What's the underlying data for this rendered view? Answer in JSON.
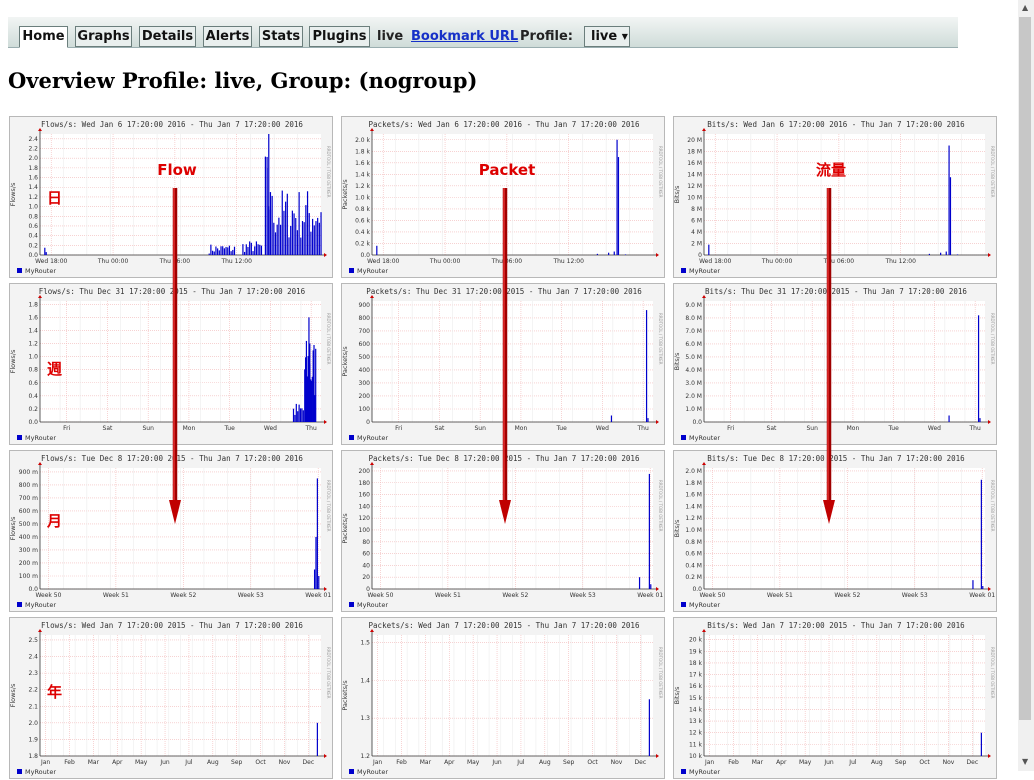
{
  "nav": {
    "tabs": [
      "Home",
      "Graphs",
      "Details",
      "Alerts",
      "Stats",
      "Plugins"
    ],
    "active_tab": "Home",
    "profile_name": "live",
    "bookmark_label": "Bookmark URL",
    "profile_label": "Profile:",
    "profile_select": "live"
  },
  "page": {
    "title": "Overview Profile: live, Group: (nogroup)"
  },
  "annotations": {
    "columns": [
      "Flow",
      "Packet",
      "流量"
    ],
    "rows": [
      "日",
      "週",
      "月",
      "年"
    ],
    "color": "#dd0000"
  },
  "colors": {
    "series": "#0000cc",
    "grid": "#f2b8b8",
    "plot_bg": "#ffffff",
    "panel_bg": "#f3f3f3"
  },
  "legend": "MyRouter",
  "side_label": "RRDTOOL / TOBI OETIKER",
  "chart_data": [
    {
      "type": "bar",
      "title": "Flows/s: Wed Jan  6 17:20:00 2016 - Thu Jan  7 17:20:00 2016",
      "ylabel": "Flows/s",
      "yticks": [
        "0.0",
        "0.2",
        "0.4",
        "0.6",
        "0.8",
        "1.0",
        "1.2",
        "1.4",
        "1.6",
        "1.8",
        "2.0",
        "2.2",
        "2.4"
      ],
      "ylim": [
        0,
        2.5
      ],
      "xticks": [
        "Wed 18:00",
        "Thu 00:00",
        "Thu 06:00",
        "Thu 12:00"
      ],
      "xtick_pos": [
        0.04,
        0.26,
        0.48,
        0.7
      ],
      "gridx": 12,
      "series": "flow_day",
      "peak": 2.5
    },
    {
      "type": "bar",
      "title": "Packets/s: Wed Jan  6 17:20:00 2016 - Thu Jan  7 17:20:00 2016",
      "ylabel": "Packets/s",
      "yticks": [
        "0.0",
        "0.2 k",
        "0.4 k",
        "0.6 k",
        "0.8 k",
        "1.0 k",
        "1.2 k",
        "1.4 k",
        "1.6 k",
        "1.8 k",
        "2.0 k"
      ],
      "ylim": [
        0,
        2.1
      ],
      "xticks": [
        "Wed 18:00",
        "Thu 00:00",
        "Thu 06:00",
        "Thu 12:00"
      ],
      "xtick_pos": [
        0.04,
        0.26,
        0.48,
        0.7
      ],
      "gridx": 12,
      "series": [
        [
          0.015,
          0.16
        ],
        [
          0.8,
          0.02
        ],
        [
          0.84,
          0.04
        ],
        [
          0.86,
          0.06
        ],
        [
          0.87,
          2.0
        ],
        [
          0.875,
          1.7
        ],
        [
          0.9,
          0.01
        ]
      ]
    },
    {
      "type": "bar",
      "title": "Bits/s: Wed Jan  6 17:20:00 2016 - Thu Jan  7 17:20:00 2016",
      "ylabel": "Bits/s",
      "yticks": [
        "0",
        "2 M",
        "4 M",
        "6 M",
        "8 M",
        "10 M",
        "12 M",
        "14 M",
        "16 M",
        "18 M",
        "20 M"
      ],
      "ylim": [
        0,
        21
      ],
      "xticks": [
        "Wed 18:00",
        "Thu 00:00",
        "Thu 06:00",
        "Thu 12:00"
      ],
      "xtick_pos": [
        0.04,
        0.26,
        0.48,
        0.7
      ],
      "gridx": 12,
      "series": [
        [
          0.015,
          1.8
        ],
        [
          0.8,
          0.2
        ],
        [
          0.84,
          0.4
        ],
        [
          0.86,
          0.6
        ],
        [
          0.87,
          19.0
        ],
        [
          0.875,
          13.5
        ],
        [
          0.9,
          0.1
        ]
      ]
    },
    {
      "type": "bar",
      "title": "Flows/s: Thu Dec 31 17:20:00 2015 - Thu Jan  7 17:20:00 2016",
      "ylabel": "Flows/s",
      "yticks": [
        "0.0",
        "0.2",
        "0.4",
        "0.6",
        "0.8",
        "1.0",
        "1.2",
        "1.4",
        "1.6",
        "1.8"
      ],
      "ylim": [
        0,
        1.85
      ],
      "xticks": [
        "Fri",
        "Sat",
        "Sun",
        "Mon",
        "Tue",
        "Wed",
        "Thu"
      ],
      "xtick_pos": [
        0.095,
        0.24,
        0.385,
        0.53,
        0.675,
        0.82,
        0.965
      ],
      "gridx": 14,
      "series": "flow_week",
      "peak": 1.6
    },
    {
      "type": "bar",
      "title": "Packets/s: Thu Dec 31 17:20:00 2015 - Thu Jan  7 17:20:00 2016",
      "ylabel": "Packets/s",
      "yticks": [
        "0",
        "100",
        "200",
        "300",
        "400",
        "500",
        "600",
        "700",
        "800",
        "900"
      ],
      "ylim": [
        0,
        930
      ],
      "xticks": [
        "Fri",
        "Sat",
        "Sun",
        "Mon",
        "Tue",
        "Wed",
        "Thu"
      ],
      "xtick_pos": [
        0.095,
        0.24,
        0.385,
        0.53,
        0.675,
        0.82,
        0.965
      ],
      "gridx": 14,
      "series": [
        [
          0.85,
          50
        ],
        [
          0.975,
          860
        ],
        [
          0.98,
          30
        ]
      ]
    },
    {
      "type": "bar",
      "title": "Bits/s: Thu Dec 31 17:20:00 2015 - Thu Jan  7 17:20:00 2016",
      "ylabel": "Bits/s",
      "yticks": [
        "0.0",
        "1.0 M",
        "2.0 M",
        "3.0 M",
        "4.0 M",
        "5.0 M",
        "6.0 M",
        "7.0 M",
        "8.0 M",
        "9.0 M"
      ],
      "ylim": [
        0,
        9.3
      ],
      "xticks": [
        "Fri",
        "Sat",
        "Sun",
        "Mon",
        "Tue",
        "Wed",
        "Thu"
      ],
      "xtick_pos": [
        0.095,
        0.24,
        0.385,
        0.53,
        0.675,
        0.82,
        0.965
      ],
      "gridx": 14,
      "series": [
        [
          0.87,
          0.5
        ],
        [
          0.975,
          8.2
        ],
        [
          0.98,
          0.3
        ]
      ]
    },
    {
      "type": "bar",
      "title": "Flows/s: Tue Dec  8 17:20:00 2015 - Thu Jan  7 17:20:00 2016",
      "ylabel": "Flows/s",
      "yticks": [
        "0.0",
        "100 m",
        "200 m",
        "300 m",
        "400 m",
        "500 m",
        "600 m",
        "700 m",
        "800 m",
        "900 m"
      ],
      "ylim": [
        0,
        930
      ],
      "xticks": [
        "Week 50",
        "Week 51",
        "Week 52",
        "Week 53",
        "Week 01"
      ],
      "xtick_pos": [
        0.03,
        0.27,
        0.51,
        0.75,
        0.99
      ],
      "gridx": 12,
      "series": [
        [
          0.975,
          150
        ],
        [
          0.98,
          400
        ],
        [
          0.985,
          850
        ],
        [
          0.99,
          100
        ]
      ]
    },
    {
      "type": "bar",
      "title": "Packets/s: Tue Dec  8 17:20:00 2015 - Thu Jan  7 17:20:00 2016",
      "ylabel": "Packets/s",
      "yticks": [
        "0",
        "20",
        "40",
        "60",
        "80",
        "100",
        "120",
        "140",
        "160",
        "180",
        "200"
      ],
      "ylim": [
        0,
        205
      ],
      "xticks": [
        "Week 50",
        "Week 51",
        "Week 52",
        "Week 53",
        "Week 01"
      ],
      "xtick_pos": [
        0.03,
        0.27,
        0.51,
        0.75,
        0.99
      ],
      "gridx": 12,
      "series": [
        [
          0.95,
          20
        ],
        [
          0.985,
          195
        ],
        [
          0.99,
          8
        ]
      ]
    },
    {
      "type": "bar",
      "title": "Bits/s: Tue Dec  8 17:20:00 2015 - Thu Jan  7 17:20:00 2016",
      "ylabel": "Bits/s",
      "yticks": [
        "0.0",
        "0.2 M",
        "0.4 M",
        "0.6 M",
        "0.8 M",
        "1.0 M",
        "1.2 M",
        "1.4 M",
        "1.6 M",
        "1.8 M",
        "2.0 M"
      ],
      "ylim": [
        0,
        2.05
      ],
      "xticks": [
        "Week 50",
        "Week 51",
        "Week 52",
        "Week 53",
        "Week 01"
      ],
      "xtick_pos": [
        0.03,
        0.27,
        0.51,
        0.75,
        0.99
      ],
      "gridx": 12,
      "series": [
        [
          0.955,
          0.15
        ],
        [
          0.985,
          1.85
        ],
        [
          0.99,
          0.05
        ]
      ]
    },
    {
      "type": "bar",
      "title": "Flows/s: Wed Jan  7 17:20:00 2015 - Thu Jan  7 17:20:00 2016",
      "ylabel": "Flows/s",
      "yticks": [
        "1.8",
        "1.9",
        "2.0",
        "2.1",
        "2.2",
        "2.3",
        "2.4",
        "2.5"
      ],
      "ylim": [
        1.8,
        2.53
      ],
      "xticks": [
        "Jan",
        "Feb",
        "Mar",
        "Apr",
        "May",
        "Jun",
        "Jul",
        "Aug",
        "Sep",
        "Oct",
        "Nov",
        "Dec"
      ],
      "xtick_pos": [
        0.02,
        0.105,
        0.19,
        0.275,
        0.36,
        0.445,
        0.53,
        0.615,
        0.7,
        0.785,
        0.87,
        0.955
      ],
      "gridx": 24,
      "series": [
        [
          0.985,
          2.0
        ]
      ]
    },
    {
      "type": "bar",
      "title": "Packets/s: Wed Jan  7 17:20:00 2015 - Thu Jan  7 17:20:00 2016",
      "ylabel": "Packets/s",
      "yticks": [
        "1.2",
        "1.3",
        "1.4",
        "1.5"
      ],
      "ylim": [
        1.2,
        1.52
      ],
      "xticks": [
        "Jan",
        "Feb",
        "Mar",
        "Apr",
        "May",
        "Jun",
        "Jul",
        "Aug",
        "Sep",
        "Oct",
        "Nov",
        "Dec"
      ],
      "xtick_pos": [
        0.02,
        0.105,
        0.19,
        0.275,
        0.36,
        0.445,
        0.53,
        0.615,
        0.7,
        0.785,
        0.87,
        0.955
      ],
      "gridx": 24,
      "series": [
        [
          0.985,
          1.35
        ]
      ]
    },
    {
      "type": "bar",
      "title": "Bits/s: Wed Jan  7 17:20:00 2015 - Thu Jan  7 17:20:00 2016",
      "ylabel": "Bits/s",
      "yticks": [
        "10 k",
        "11 k",
        "12 k",
        "13 k",
        "14 k",
        "15 k",
        "16 k",
        "17 k",
        "18 k",
        "19 k",
        "20 k"
      ],
      "ylim": [
        10,
        20.4
      ],
      "xticks": [
        "Jan",
        "Feb",
        "Mar",
        "Apr",
        "May",
        "Jun",
        "Jul",
        "Aug",
        "Sep",
        "Oct",
        "Nov",
        "Dec"
      ],
      "xtick_pos": [
        0.02,
        0.105,
        0.19,
        0.275,
        0.36,
        0.445,
        0.53,
        0.615,
        0.7,
        0.785,
        0.87,
        0.955
      ],
      "gridx": 24,
      "series": [
        [
          0.985,
          12.0
        ]
      ]
    }
  ]
}
